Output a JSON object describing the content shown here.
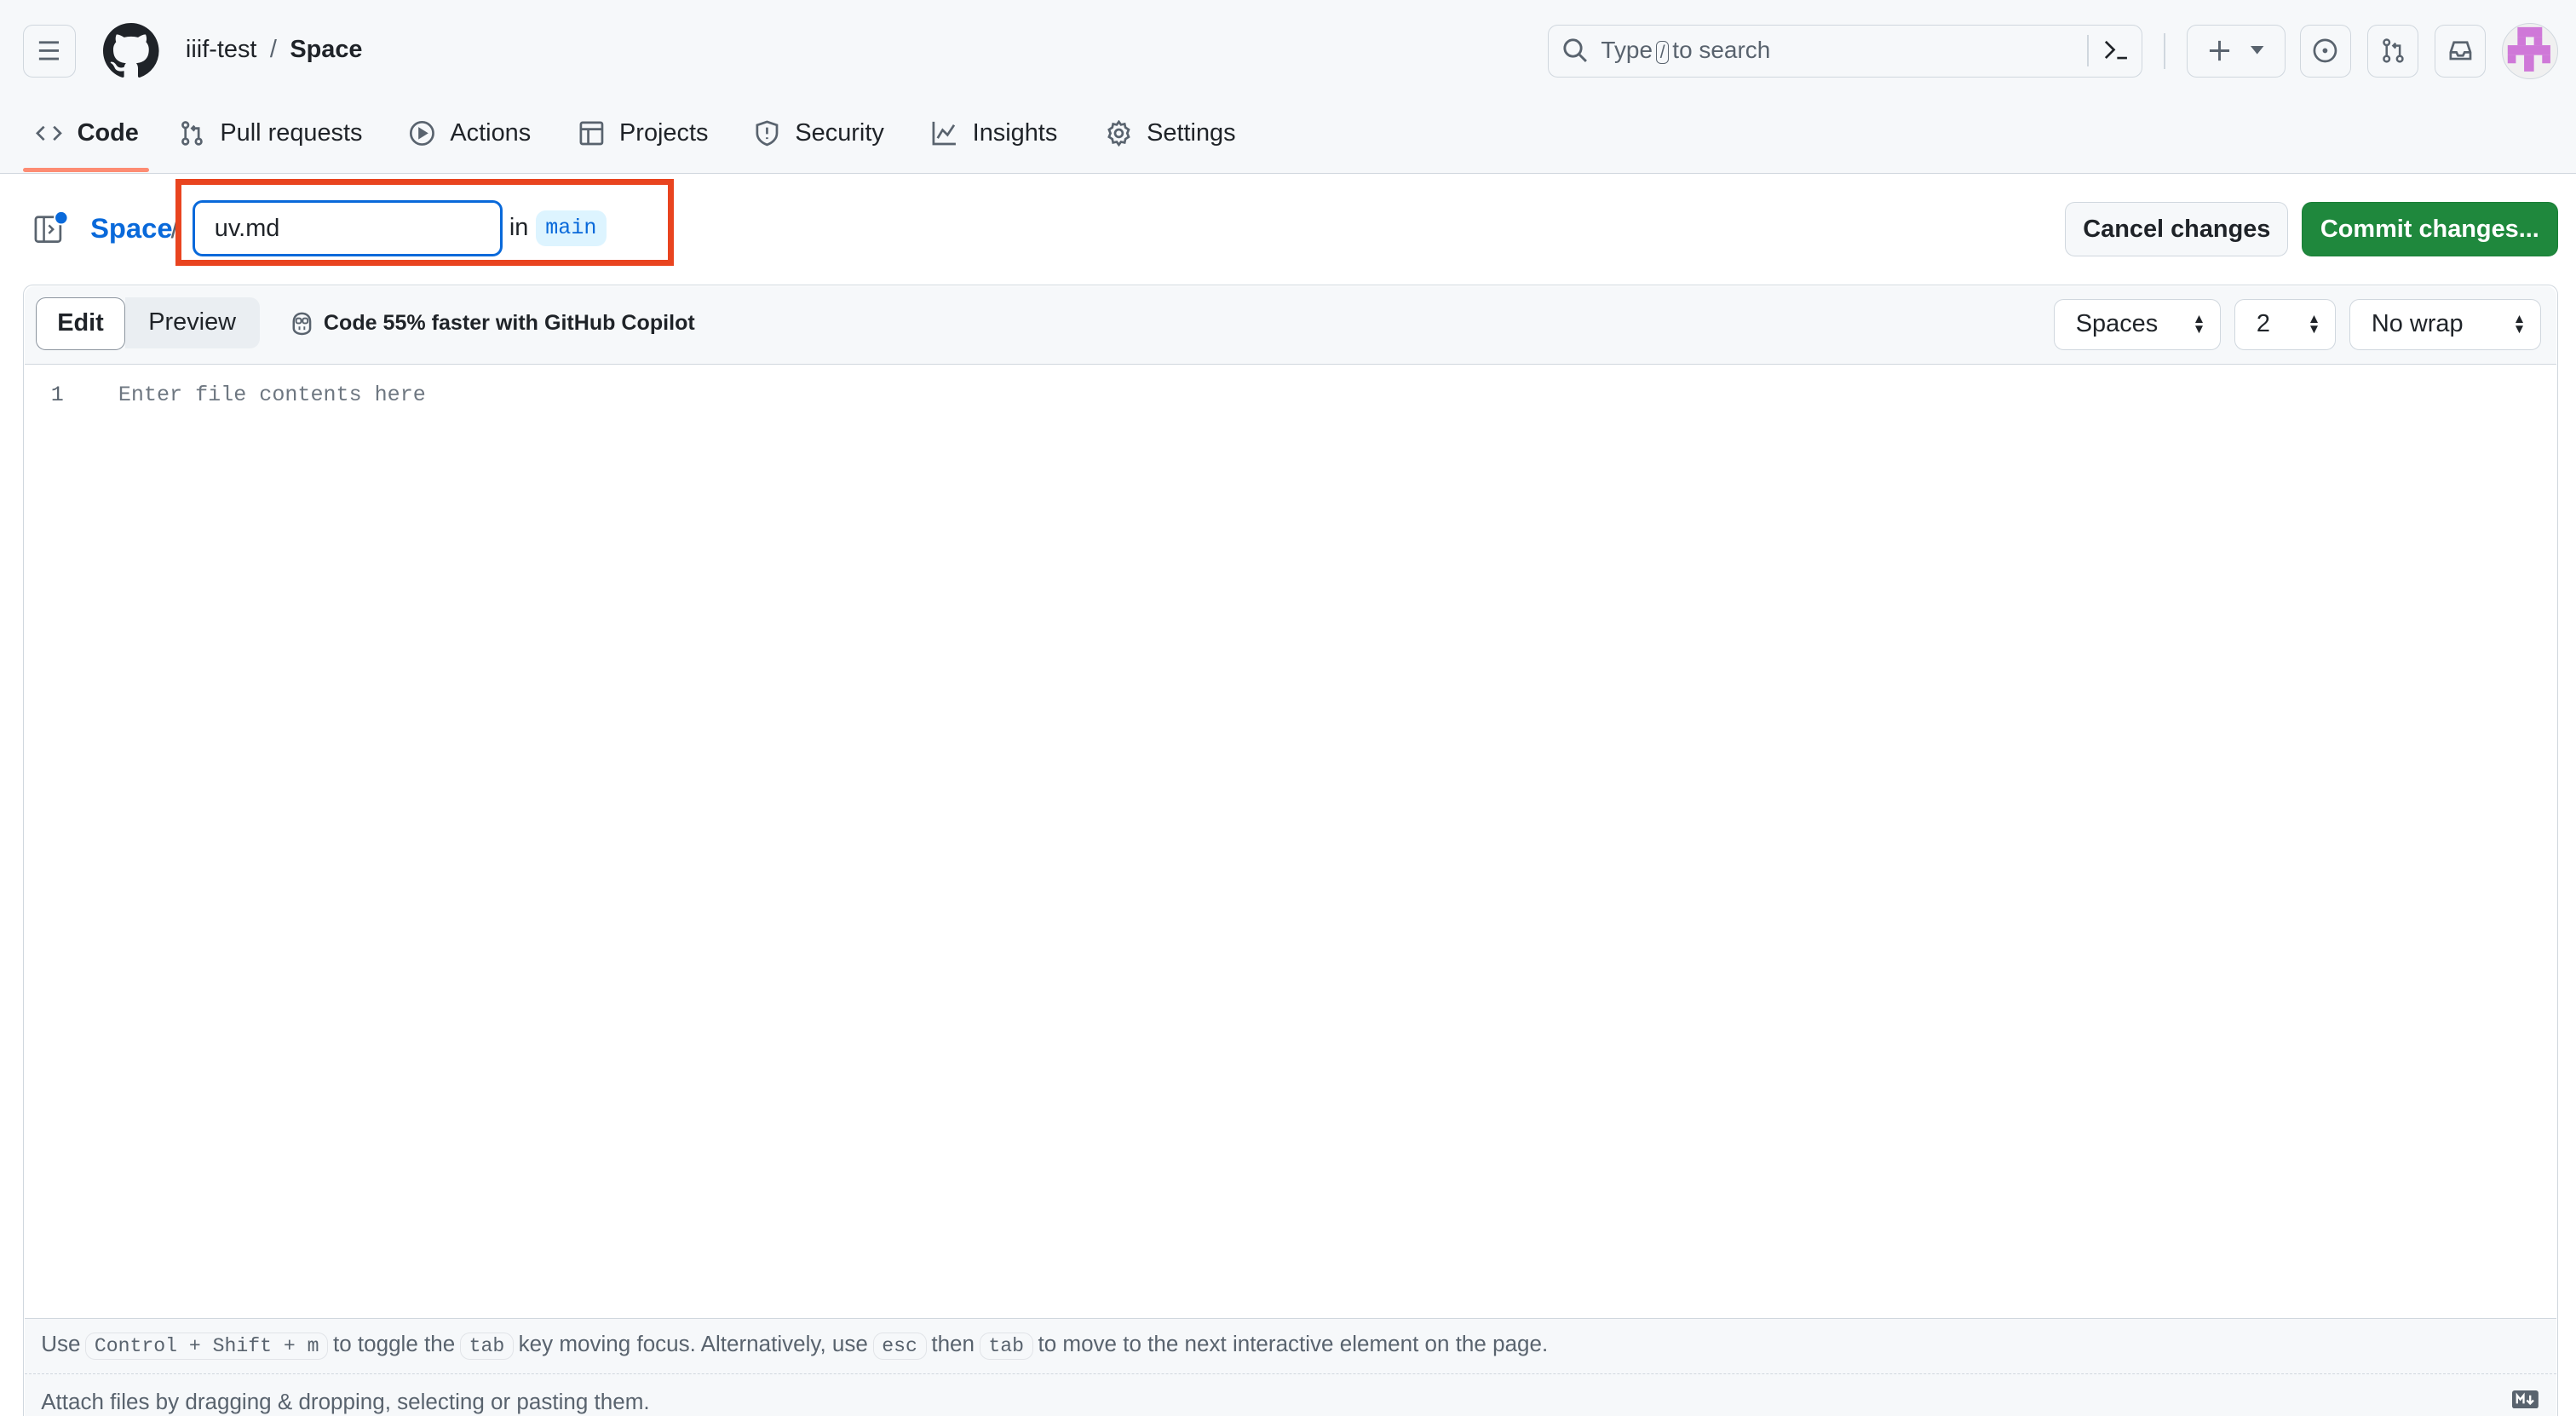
{
  "header": {
    "owner": "iiif-test",
    "separator": "/",
    "repo": "Space",
    "search_prefix": "Type",
    "search_key": "/",
    "search_suffix": "to search"
  },
  "nav": {
    "tabs": [
      {
        "label": "Code",
        "icon": "code-icon",
        "active": true
      },
      {
        "label": "Pull requests",
        "icon": "git-pull-request-icon"
      },
      {
        "label": "Actions",
        "icon": "play-icon"
      },
      {
        "label": "Projects",
        "icon": "table-icon"
      },
      {
        "label": "Security",
        "icon": "shield-icon"
      },
      {
        "label": "Insights",
        "icon": "graph-icon"
      },
      {
        "label": "Settings",
        "icon": "gear-icon"
      }
    ],
    "active_underline_color": "#fd8c73"
  },
  "file_bar": {
    "repo_link": "Space",
    "slash": "/",
    "filename_value": "uv.md",
    "in_label": "in",
    "branch": "main",
    "highlight_color": "#e9441f",
    "cancel_label": "Cancel changes",
    "commit_label": "Commit changes...",
    "commit_color": "#1f883d"
  },
  "editor": {
    "edit_tab": "Edit",
    "preview_tab": "Preview",
    "copilot_text": "Code 55% faster with GitHub Copilot",
    "indent_mode": "Spaces",
    "indent_size": "2",
    "wrap_mode": "No wrap",
    "line_number": "1",
    "placeholder": "Enter file contents here"
  },
  "footer": {
    "t1": "Use",
    "k1": "Control + Shift + m",
    "t2": "to toggle the",
    "k2": "tab",
    "t3": "key moving focus. Alternatively, use",
    "k3": "esc",
    "t4": "then",
    "k4": "tab",
    "t5": "to move to the next interactive element on the page.",
    "attach": "Attach files by dragging & dropping, selecting or pasting them."
  }
}
